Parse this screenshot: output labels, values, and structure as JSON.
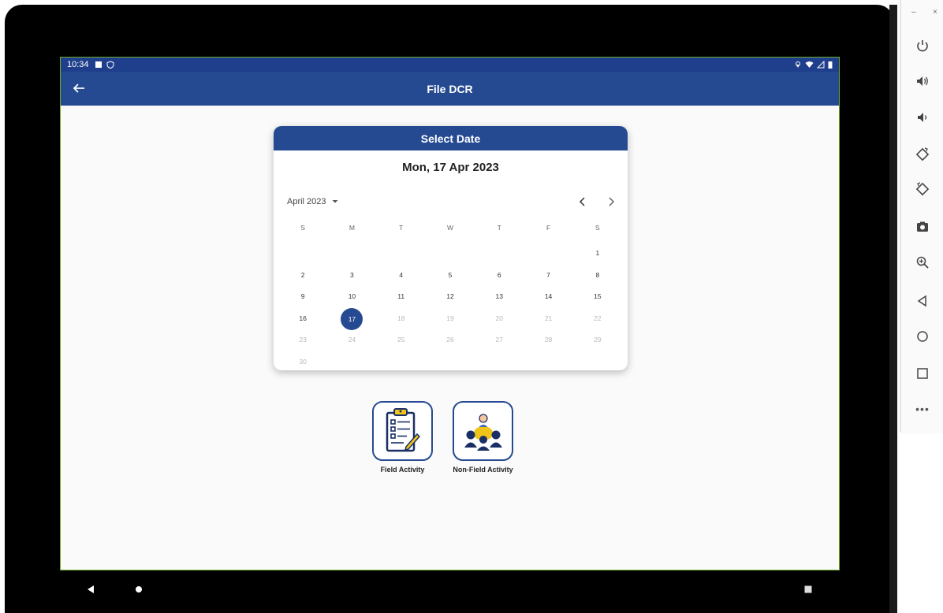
{
  "status_bar": {
    "time": "10:34"
  },
  "app_bar": {
    "title": "File DCR"
  },
  "date_picker": {
    "header": "Select Date",
    "selected_date": "Mon, 17 Apr 2023",
    "month_label": "April 2023",
    "weekdays": [
      "S",
      "M",
      "T",
      "W",
      "T",
      "F",
      "S"
    ],
    "weeks": [
      [
        {
          "d": ""
        },
        {
          "d": ""
        },
        {
          "d": ""
        },
        {
          "d": ""
        },
        {
          "d": ""
        },
        {
          "d": ""
        },
        {
          "d": "1"
        }
      ],
      [
        {
          "d": "2"
        },
        {
          "d": "3"
        },
        {
          "d": "4"
        },
        {
          "d": "5"
        },
        {
          "d": "6"
        },
        {
          "d": "7"
        },
        {
          "d": "8"
        }
      ],
      [
        {
          "d": "9"
        },
        {
          "d": "10"
        },
        {
          "d": "11"
        },
        {
          "d": "12"
        },
        {
          "d": "13"
        },
        {
          "d": "14"
        },
        {
          "d": "15"
        }
      ],
      [
        {
          "d": "16"
        },
        {
          "d": "17",
          "selected": true
        },
        {
          "d": "18",
          "disabled": true
        },
        {
          "d": "19",
          "disabled": true
        },
        {
          "d": "20",
          "disabled": true
        },
        {
          "d": "21",
          "disabled": true
        },
        {
          "d": "22",
          "disabled": true
        }
      ],
      [
        {
          "d": "23",
          "disabled": true
        },
        {
          "d": "24",
          "disabled": true
        },
        {
          "d": "25",
          "disabled": true
        },
        {
          "d": "26",
          "disabled": true
        },
        {
          "d": "27",
          "disabled": true
        },
        {
          "d": "28",
          "disabled": true
        },
        {
          "d": "29",
          "disabled": true
        }
      ],
      [
        {
          "d": "30",
          "disabled": true
        },
        {
          "d": ""
        },
        {
          "d": ""
        },
        {
          "d": ""
        },
        {
          "d": ""
        },
        {
          "d": ""
        },
        {
          "d": ""
        }
      ]
    ]
  },
  "activities": {
    "field_label": "Field Activity",
    "non_field_label": "Non-Field Activity"
  },
  "colors": {
    "primary": "#254a92",
    "background": "#fafafa",
    "disabled_day": "#b8b8b8",
    "icon_yellow": "#f0c419"
  },
  "icons": {
    "status_bar": [
      "notification-icon",
      "shield-icon",
      "location-icon",
      "wifi-icon",
      "signal-icon",
      "battery-icon"
    ],
    "app_bar": "back-arrow-icon",
    "navigation": [
      "back-triangle-icon",
      "home-circle-icon",
      "recents-square-icon"
    ],
    "emulator_panel": [
      "power-icon",
      "volume-up-icon",
      "volume-down-icon",
      "rotate-left-icon",
      "rotate-right-icon",
      "camera-icon",
      "zoom-icon",
      "back-icon",
      "home-icon",
      "overview-icon",
      "more-icon"
    ]
  }
}
